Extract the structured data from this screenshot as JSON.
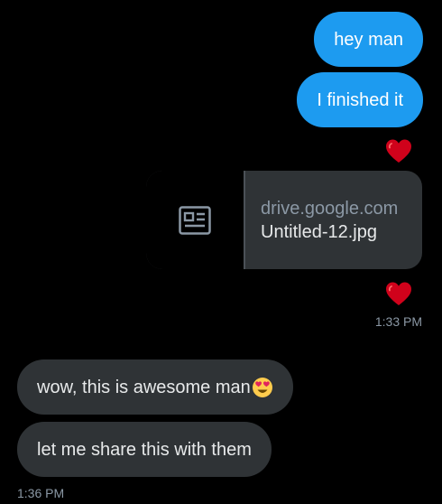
{
  "messages": {
    "out_1": "hey man",
    "out_2": "I finished it",
    "in_1": "wow, this is awesome man",
    "in_2": "let me share this with them"
  },
  "link_card": {
    "domain": "drive.google.com",
    "title": "Untitled-12.jpg",
    "icon": "article-icon"
  },
  "timestamps": {
    "sent": "1:33 PM",
    "received": "1:36 PM"
  },
  "reactions": {
    "heart_1": "heart-icon",
    "heart_2": "heart-icon",
    "emoji": "heart-eyes-emoji"
  },
  "colors": {
    "background": "#000000",
    "outgoing_bubble": "#1d9bf0",
    "incoming_bubble": "#2f3336",
    "heart": "#d0021b",
    "timestamp": "#8b98a5"
  }
}
